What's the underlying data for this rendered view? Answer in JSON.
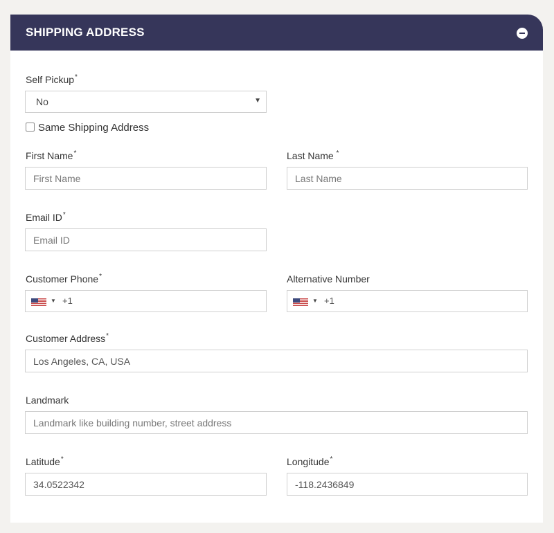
{
  "section": {
    "title": "SHIPPING ADDRESS",
    "collapse_icon": "minus-circle-icon"
  },
  "self_pickup": {
    "label": "Self Pickup",
    "required_mark": "*",
    "selected": "No",
    "caret": "▼"
  },
  "same_shipping": {
    "label": "Same Shipping Address",
    "checked": false
  },
  "first_name": {
    "label": "First Name",
    "required_mark": "*",
    "placeholder": "First Name",
    "value": ""
  },
  "last_name": {
    "label": "Last Name",
    "required_mark": " *",
    "placeholder": "Last Name",
    "value": ""
  },
  "email": {
    "label": "Email ID",
    "required_mark": "*",
    "placeholder": "Email ID",
    "value": ""
  },
  "customer_phone": {
    "label": "Customer Phone",
    "required_mark": "*",
    "country_flag": "us-flag-icon",
    "caret": "▼",
    "dial_code": "+1"
  },
  "alternative_number": {
    "label": "Alternative Number",
    "country_flag": "us-flag-icon",
    "caret": "▼",
    "dial_code": "+1"
  },
  "customer_address": {
    "label": "Customer Address",
    "required_mark": "*",
    "value": "Los Angeles, CA, USA"
  },
  "landmark": {
    "label": "Landmark",
    "placeholder": "Landmark like building number, street address",
    "value": ""
  },
  "latitude": {
    "label": "Latitude",
    "required_mark": "*",
    "value": "34.0522342"
  },
  "longitude": {
    "label": "Longitude",
    "required_mark": "*",
    "value": "-118.2436849"
  },
  "colors": {
    "header_bg": "#36365a",
    "header_text": "#ffffff",
    "page_bg": "#f3f2ef",
    "border": "#cfcfcf"
  }
}
